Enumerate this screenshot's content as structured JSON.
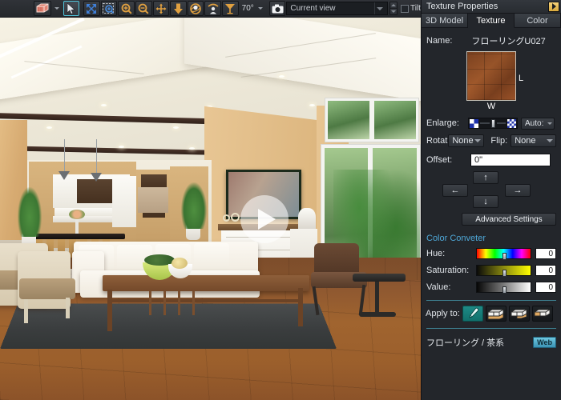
{
  "toolbar": {
    "tools": [
      {
        "name": "object-box-tool",
        "icon": "box-icon"
      },
      {
        "name": "select-arrow-tool",
        "icon": "cursor-arrow-icon",
        "selected": true
      },
      {
        "name": "fit-to-screen-tool",
        "icon": "fit-screen-icon"
      },
      {
        "name": "zoom-window-tool",
        "icon": "zoom-window-icon"
      },
      {
        "name": "zoom-in-tool",
        "icon": "magnifier-plus-icon"
      },
      {
        "name": "zoom-out-tool",
        "icon": "magnifier-minus-icon"
      },
      {
        "name": "pan-tool",
        "icon": "move-arrows-icon"
      },
      {
        "name": "drop-tool",
        "icon": "drop-down-arrow-icon"
      },
      {
        "name": "orbit-tool",
        "icon": "orbit-icon"
      },
      {
        "name": "walkthrough-tool",
        "icon": "person-view-icon"
      },
      {
        "name": "field-of-view-tool",
        "icon": "cone-fov-icon"
      }
    ],
    "angle_value": "70°",
    "camera_icon": "camera-icon",
    "view_select": "Current view",
    "tilt_label": "Tilt",
    "tilt_checked": false
  },
  "viewport": {
    "play_overlay_label": "play-button",
    "scene": "3D interior living room with kitchen, sofa, coffee table, armchairs, rug and wood floor"
  },
  "panel": {
    "title": "Texture Properties",
    "collapse_icon": "collapse-panel-icon",
    "tabs": [
      {
        "label": "3D Model",
        "active": false
      },
      {
        "label": "Texture",
        "active": true
      },
      {
        "label": "Color",
        "active": false
      }
    ],
    "name_label": "Name:",
    "name_value": "フローリングU027",
    "swatch": {
      "icon": "texture-swatch",
      "label_height": "L",
      "label_width": "W"
    },
    "enlarge_label": "Enlarge:",
    "enlarge_mode": "Auto:",
    "rotate_label": "Rotat",
    "rotate_value": "None",
    "flip_label": "Flip:",
    "flip_value": "None",
    "offset_label": "Offset:",
    "offset_value": "0\"",
    "arrows": {
      "up": "↑",
      "down": "↓",
      "left": "←",
      "right": "→"
    },
    "advanced_settings": "Advanced Settings",
    "color_converter_title": "Color Conveter",
    "hsv": [
      {
        "label": "Hue:",
        "value": "0",
        "slider": "hue-slider"
      },
      {
        "label": "Saturation:",
        "value": "0",
        "slider": "saturation-slider"
      },
      {
        "label": "Value:",
        "value": "0",
        "slider": "value-slider"
      }
    ],
    "apply_to_label": "Apply to:",
    "apply_buttons": [
      {
        "name": "apply-to-picked-surface",
        "icon": "eyedropper-icon",
        "active": true
      },
      {
        "name": "apply-to-all-same-surfaces",
        "icon": "room-surfaces-icon-1",
        "active": false
      },
      {
        "name": "apply-to-room",
        "icon": "room-surfaces-icon-2",
        "active": false
      },
      {
        "name": "apply-to-all-rooms",
        "icon": "room-surfaces-icon-3",
        "active": false
      }
    ],
    "footer_text": "フローリング / 茶系",
    "web_badge": "Web"
  },
  "colors": {
    "accent_cyan": "#4fc3d9",
    "panel_bg": "#23262b",
    "cc_title": "#4fa8d8",
    "divider": "#3d7f8f",
    "web_badge": "#6fc8e0"
  }
}
